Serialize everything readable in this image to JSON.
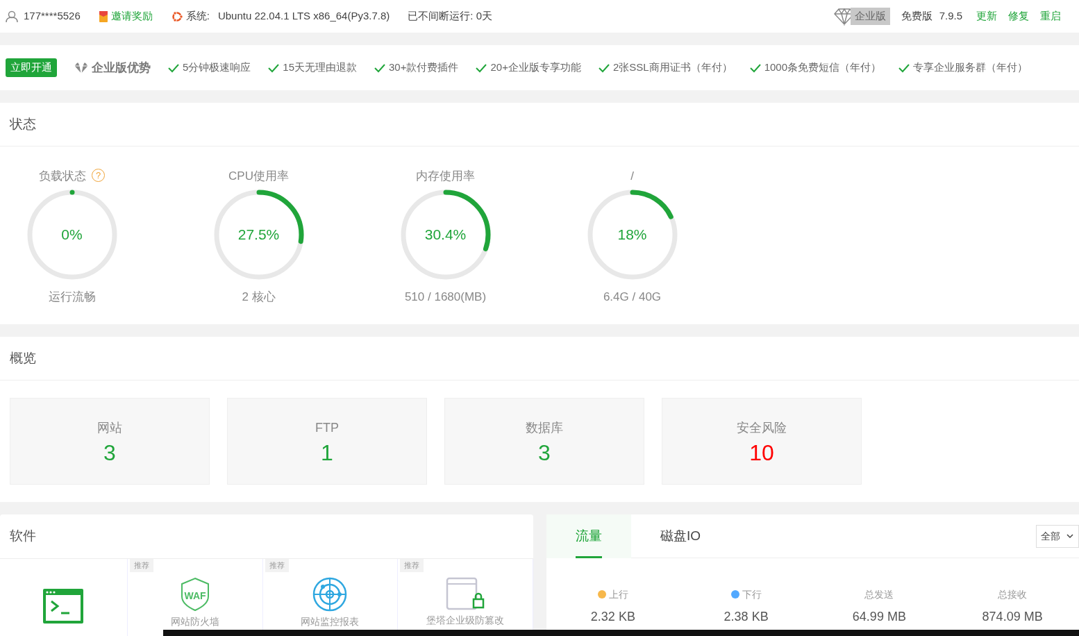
{
  "top_bar": {
    "user": "177****5526",
    "invite": "邀请奖励",
    "system_label": "系统:",
    "system": "Ubuntu 22.04.1 LTS x86_64(Py3.7.8)",
    "uptime": "已不间断运行: 0天",
    "enterprise": "企业版",
    "edition": "免费版",
    "version": "7.9.5",
    "actions": [
      "更新",
      "修复",
      "重启"
    ]
  },
  "promo": {
    "button": "立即开通",
    "title": "企业版优势",
    "features": [
      "5分钟极速响应",
      "15天无理由退款",
      "30+款付费插件",
      "20+企业版专享功能",
      "2张SSL商用证书（年付）",
      "1000条免费短信（年付）",
      "专享企业服务群（年付）"
    ]
  },
  "status": {
    "title": "状态",
    "gauges": [
      {
        "label": "负载状态",
        "help": "?",
        "value": "0%",
        "level": 0,
        "caption": "运行流畅"
      },
      {
        "label": "CPU使用率",
        "value": "27.5%",
        "level": 0.275,
        "caption": "2 核心"
      },
      {
        "label": "内存使用率",
        "value": "30.4%",
        "level": 0.304,
        "caption": "510 / 1680(MB)"
      },
      {
        "label": "/",
        "value": "18%",
        "level": 0.18,
        "caption": "6.4G / 40G"
      }
    ]
  },
  "overview": {
    "title": "概览",
    "cards": [
      {
        "label": "网站",
        "value": "3",
        "alert": false
      },
      {
        "label": "FTP",
        "value": "1",
        "alert": false
      },
      {
        "label": "数据库",
        "value": "3",
        "alert": false
      },
      {
        "label": "安全风险",
        "value": "10",
        "alert": true
      }
    ]
  },
  "software": {
    "title": "软件",
    "items": [
      {
        "kind": "terminal"
      },
      {
        "kind": "waf",
        "tag": "推荐",
        "icon_text": "WAF",
        "name": "网站防火墙"
      },
      {
        "kind": "monitor",
        "tag": "推荐",
        "name": "网站监控报表"
      },
      {
        "kind": "tamper",
        "tag": "推荐",
        "name": "堡塔企业级防篡改"
      }
    ]
  },
  "traffic": {
    "tabs": [
      {
        "label": "流量",
        "selected": true
      },
      {
        "label": "磁盘IO",
        "selected": false
      }
    ],
    "select": "全部",
    "stats": [
      {
        "label": "上行",
        "value": "2.32 KB",
        "color": "#f7b84b"
      },
      {
        "label": "下行",
        "value": "2.38 KB",
        "color": "#52a9ff"
      },
      {
        "label": "总发送",
        "value": "64.99 MB"
      },
      {
        "label": "总接收",
        "value": "874.09 MB"
      }
    ]
  }
}
